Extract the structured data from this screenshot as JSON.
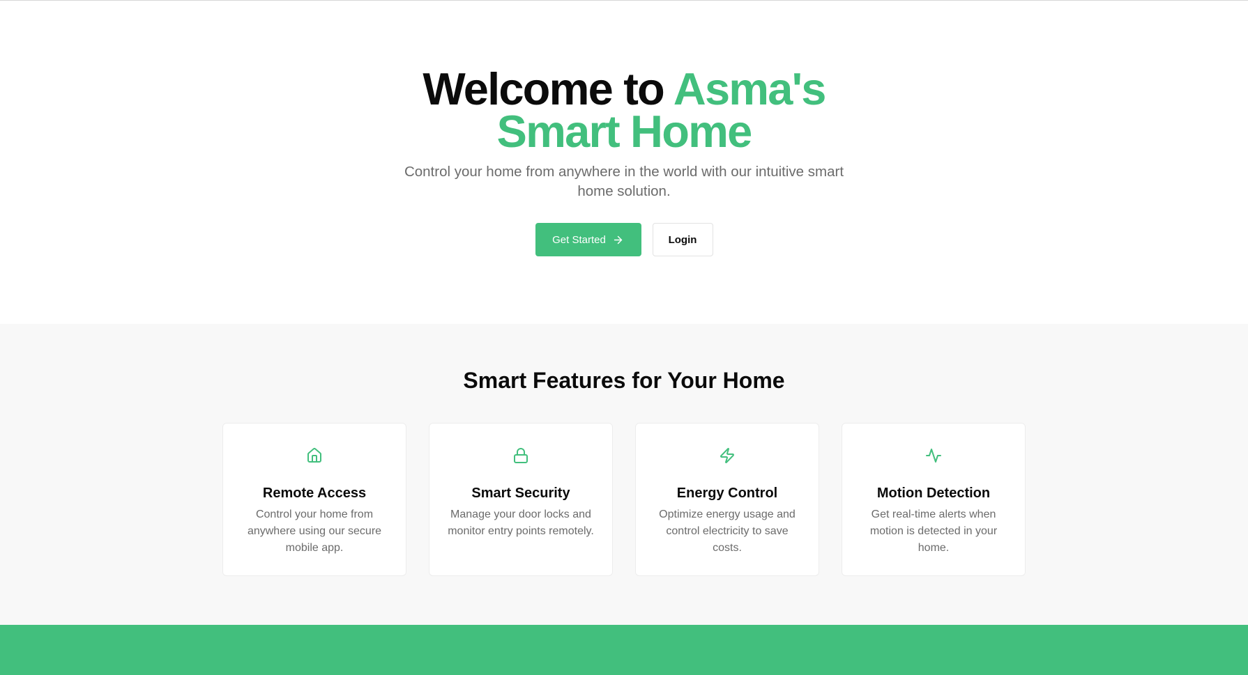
{
  "colors": {
    "accent": "#42bf7d",
    "text_primary": "#0b0b0b",
    "text_muted": "#6b6b6b",
    "section_bg": "#f8f8f8"
  },
  "hero": {
    "title_prefix": "Welcome to ",
    "title_accent": "Asma's Smart Home",
    "subtitle": "Control your home from anywhere in the world with our intuitive smart home solution.",
    "primary_button_label": "Get Started",
    "primary_button_icon": "arrow-right-icon",
    "secondary_button_label": "Login"
  },
  "features": {
    "title": "Smart Features for Your Home",
    "items": [
      {
        "icon": "home-icon",
        "name": "Remote Access",
        "description": "Control your home from anywhere using our secure mobile app."
      },
      {
        "icon": "lock-icon",
        "name": "Smart Security",
        "description": "Manage your door locks and monitor entry points remotely."
      },
      {
        "icon": "zap-icon",
        "name": "Energy Control",
        "description": "Optimize energy usage and control electricity to save costs."
      },
      {
        "icon": "activity-icon",
        "name": "Motion Detection",
        "description": "Get real-time alerts when motion is detected in your home."
      }
    ]
  }
}
